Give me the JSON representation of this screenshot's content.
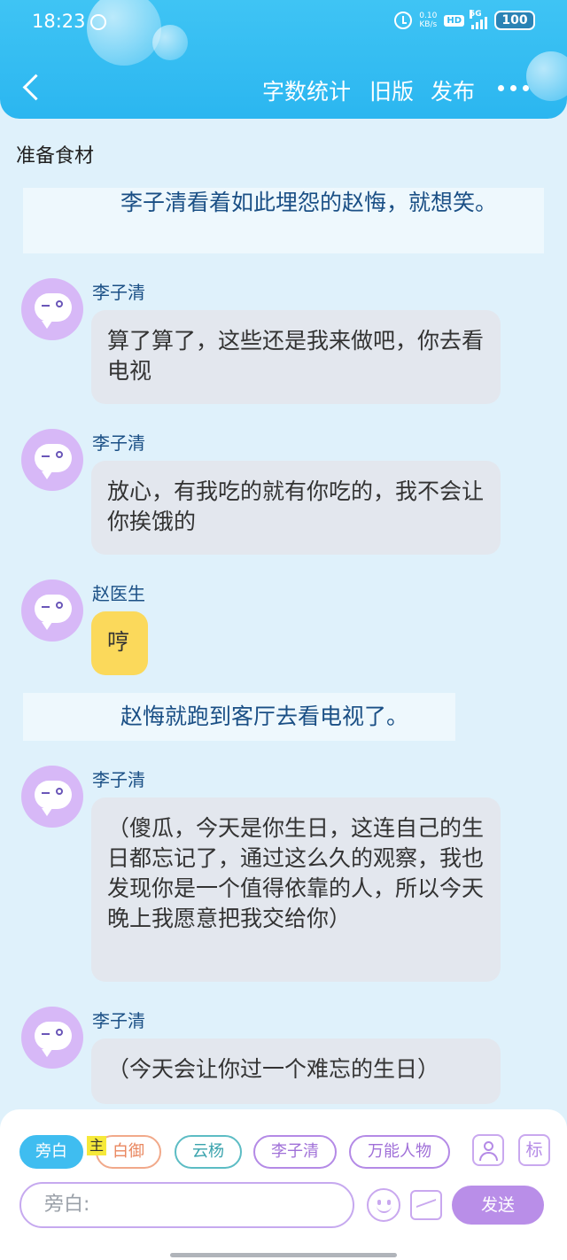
{
  "status_bar": {
    "time": "18:23",
    "net_speed_value": "0.10",
    "net_speed_unit": "KB/s",
    "hd": "HD",
    "network": "5G",
    "battery": "100"
  },
  "header": {
    "nav": [
      "字数统计",
      "旧版",
      "发布"
    ]
  },
  "section_title": "准备食材",
  "narrations": [
    "李子清看着如此埋怨的赵悔，就想笑。",
    "赵悔就跑到客厅去看电视了。"
  ],
  "messages": [
    {
      "name": "李子清",
      "text": "算了算了，这些还是我来做吧，你去看电视"
    },
    {
      "name": "李子清",
      "text": "放心，有我吃的就有你吃的，我不会让你挨饿的"
    },
    {
      "name": "赵医生",
      "text": "哼"
    },
    {
      "name": "李子清",
      "text": "（傻瓜，今天是你生日，这连自己的生日都忘记了，通过这么久的观察，我也发现你是一个值得依靠的人，所以今天晚上我愿意把我交给你）"
    },
    {
      "name": "李子清",
      "text": "（今天会让你过一个难忘的生日）"
    }
  ],
  "roles": [
    "旁白",
    "白御",
    "云杨",
    "李子清",
    "万能人物"
  ],
  "main_tag": "主",
  "tag_button": "标",
  "input_placeholder": "旁白:",
  "send_label": "发送",
  "colors": {
    "header": "#2bb6f0",
    "background": "#dff1fb",
    "accent": "#b98ee8",
    "narration_text": "#1a4f85"
  }
}
